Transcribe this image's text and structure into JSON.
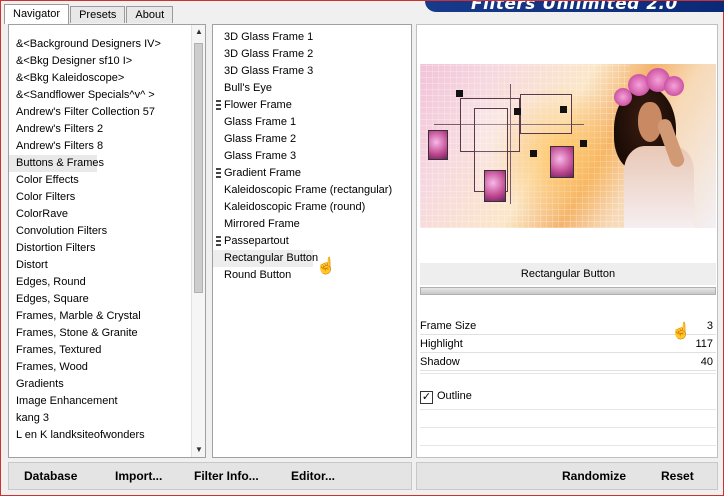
{
  "tabs": [
    {
      "label": "Navigator",
      "active": true
    },
    {
      "label": "Presets",
      "active": false
    },
    {
      "label": "About",
      "active": false
    }
  ],
  "banner": {
    "text": "Filters Unlimited 2.0",
    "color": "#183a8a"
  },
  "filter_list": {
    "selected": "Buttons & Frames",
    "items": [
      "&<Background Designers IV>",
      "&<Bkg Designer sf10 I>",
      "&<Bkg Kaleidoscope>",
      "&<Sandflower Specials^v^ >",
      "Andrew's Filter Collection 57",
      "Andrew's Filters 2",
      "Andrew's Filters 8",
      "Buttons & Frames",
      "Color Effects",
      "Color Filters",
      "ColorRave",
      "Convolution Filters",
      "Distortion Filters",
      "Distort",
      "Edges, Round",
      "Edges, Square",
      "Frames, Marble & Crystal",
      "Frames, Stone & Granite",
      "Frames, Textured",
      "Frames, Wood",
      "Gradients",
      "Image Enhancement",
      "kang 3",
      "L en K landksiteofwonders"
    ]
  },
  "effect_list": {
    "selected": "Rectangular Button",
    "items": [
      {
        "label": "3D Glass Frame 1",
        "grip": false
      },
      {
        "label": "3D Glass Frame 2",
        "grip": false
      },
      {
        "label": "3D Glass Frame 3",
        "grip": false
      },
      {
        "label": "Bull's Eye",
        "grip": false
      },
      {
        "label": "Flower Frame",
        "grip": true
      },
      {
        "label": "Glass Frame 1",
        "grip": false
      },
      {
        "label": "Glass Frame 2",
        "grip": false
      },
      {
        "label": "Glass Frame 3",
        "grip": false
      },
      {
        "label": "Gradient Frame",
        "grip": true
      },
      {
        "label": "Kaleidoscopic Frame (rectangular)",
        "grip": false
      },
      {
        "label": "Kaleidoscopic Frame (round)",
        "grip": false
      },
      {
        "label": "Mirrored Frame",
        "grip": false
      },
      {
        "label": "Passepartout",
        "grip": true
      },
      {
        "label": "Rectangular Button",
        "grip": false
      },
      {
        "label": "Round Button",
        "grip": false
      }
    ]
  },
  "preview": {
    "effect_name": "Rectangular Button"
  },
  "params": [
    {
      "label": "Frame Size",
      "value": "3"
    },
    {
      "label": "Highlight",
      "value": "117"
    },
    {
      "label": "Shadow",
      "value": "40"
    }
  ],
  "outline": {
    "label": "Outline",
    "checked": true,
    "check_mark": "✓"
  },
  "buttons": {
    "database": "Database",
    "import": "Import...",
    "filter_info": "Filter Info...",
    "editor": "Editor...",
    "randomize": "Randomize",
    "reset": "Reset"
  },
  "icons": {
    "scroll_up": "▲",
    "scroll_down": "▼",
    "hand_cursor": "☝"
  }
}
